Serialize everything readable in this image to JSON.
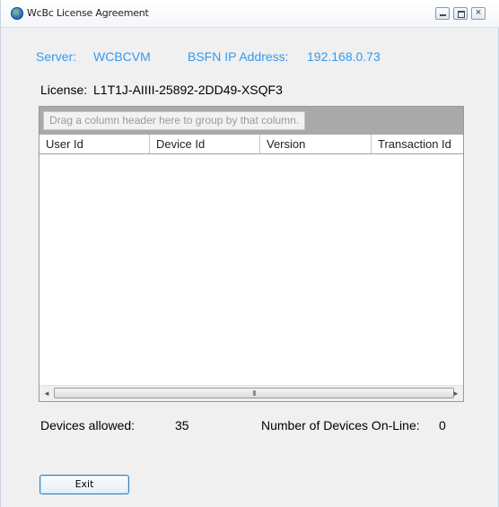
{
  "window": {
    "title": "WcBc License Agreement",
    "minimize_glyph": "–",
    "maximize_glyph": "□",
    "close_glyph": "✕"
  },
  "header": {
    "server_label": "Server:",
    "server_value": "WCBCVM",
    "bsfn_label": "BSFN IP Address:",
    "bsfn_value": "192.168.0.73",
    "accent_color": "#3399ee"
  },
  "license": {
    "label": "License:",
    "value": "L1T1J-AIIII-25892-2DD49-XSQF3"
  },
  "grid": {
    "group_hint": "Drag a column header here to group by that column.",
    "columns": [
      "User Id",
      "Device Id",
      "Version",
      "Transaction Id"
    ],
    "rows": [],
    "scroll_left_glyph": "◄",
    "scroll_right_glyph": "►",
    "scroll_grip_glyph": "III"
  },
  "footer": {
    "devices_allowed_label": "Devices allowed:",
    "devices_allowed_value": "35",
    "online_label": "Number of Devices On-Line:",
    "online_value": "0"
  },
  "actions": {
    "exit_label": "Exit"
  },
  "icons": {
    "app": "globe-icon",
    "minimize": "minimize-icon",
    "maximize": "maximize-icon",
    "close": "close-icon"
  }
}
